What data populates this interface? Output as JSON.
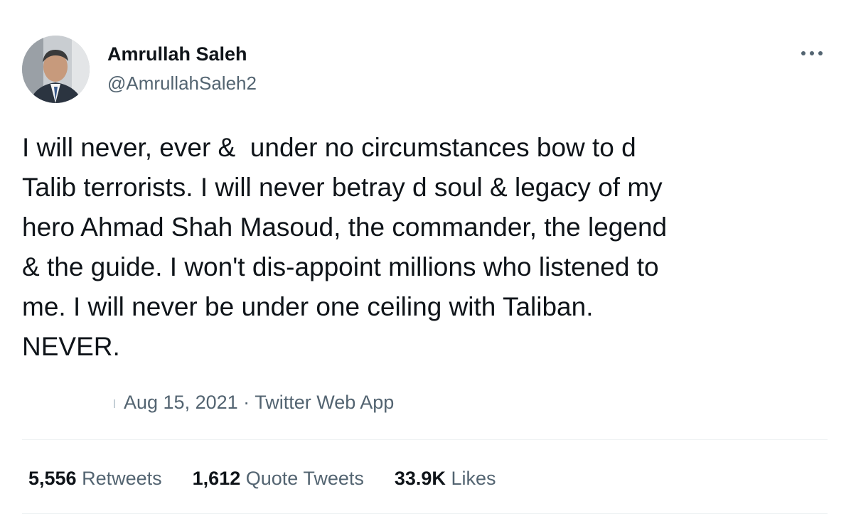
{
  "author": {
    "name": "Amrullah Saleh",
    "handle": "@AmrullahSaleh2",
    "avatar_icon": "profile-photo"
  },
  "more_icon": "more-horizontal-icon",
  "tweet": {
    "text": "I will never, ever &  under no circumstances bow to d\nTalib terrorists. I will never betray d soul & legacy of my\nhero Ahmad Shah Masoud, the commander, the legend\n& the guide. I won't dis-appoint millions who listened to\nme. I will never be under one ceiling with Taliban.\nNEVER."
  },
  "meta": {
    "date": "Aug 15, 2021",
    "separator": "·",
    "source": "Twitter Web App"
  },
  "stats": [
    {
      "count": "5,556",
      "label": "Retweets"
    },
    {
      "count": "1,612",
      "label": "Quote Tweets"
    },
    {
      "count": "33.9K",
      "label": "Likes"
    }
  ],
  "colors": {
    "text_primary": "#0f1419",
    "text_secondary": "#536471",
    "divider": "#eff3f4"
  }
}
